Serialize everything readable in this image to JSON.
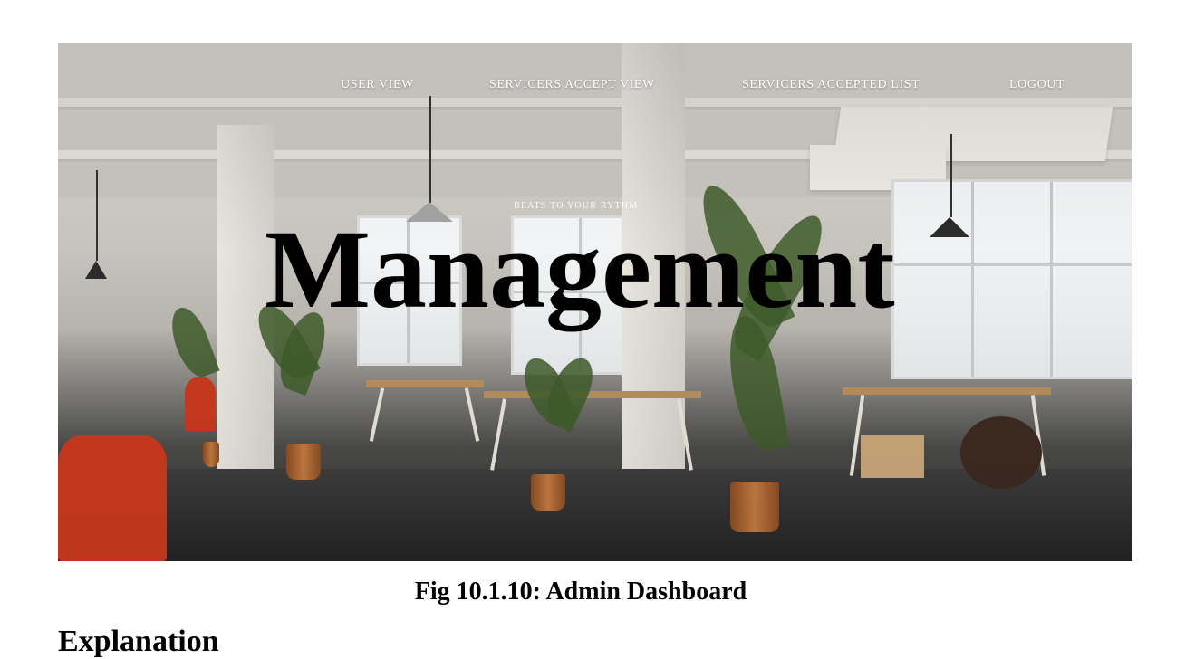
{
  "nav": {
    "items": [
      {
        "label": "USER VIEW"
      },
      {
        "label": "SERVICERS ACCEPT VIEW"
      },
      {
        "label": "SERVICERS ACCEPTED LIST"
      },
      {
        "label": "LOGOUT"
      }
    ]
  },
  "hero": {
    "tagline": "BEATS TO YOUR RYTHM",
    "headline": "Management"
  },
  "caption": "Fig 10.1.10: Admin Dashboard",
  "next_heading": "Explanation"
}
